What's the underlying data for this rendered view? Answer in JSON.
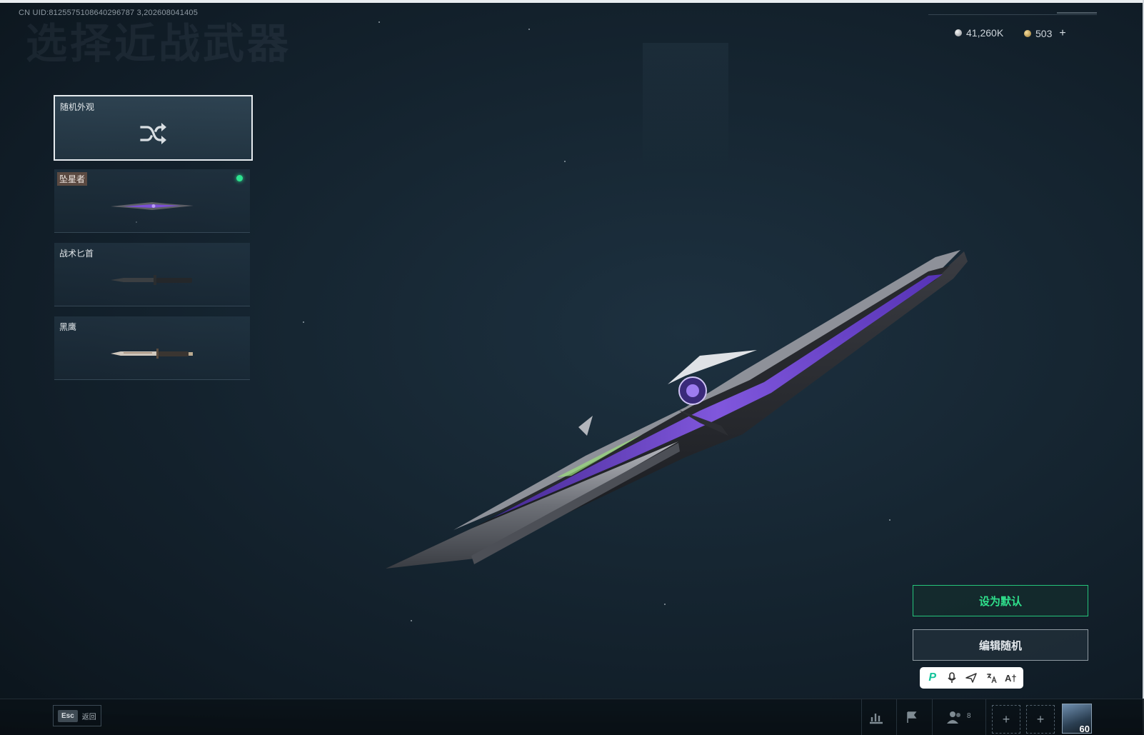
{
  "header": {
    "uid": "CN UID:8125575108640296787 3,202608041405",
    "title": "选择近战武器"
  },
  "currency": {
    "silver": "41,260K",
    "gold": "503",
    "add_label": "+"
  },
  "items": [
    {
      "label": "随机外观",
      "icon": "shuffle-icon",
      "selected": true
    },
    {
      "label": "坠星者",
      "equipped": true
    },
    {
      "label": "战术匕首"
    },
    {
      "label": "黑鹰"
    }
  ],
  "actions": {
    "set_default": "设为默认",
    "edit_random": "编辑随机"
  },
  "toolbar": {
    "icons": [
      "brand-p-icon",
      "microphone-icon",
      "send-icon",
      "translate-icon",
      "ai-text-icon"
    ],
    "ai_label": "A†"
  },
  "bottom": {
    "esc_key": "Esc",
    "esc_label": "返回",
    "friends_count": "8",
    "level": "60",
    "slot_label": "+"
  },
  "colors": {
    "accent_green": "#2fe08c",
    "equipped_dot": "#2de38f",
    "blade_purple": "#7a3fe0"
  }
}
